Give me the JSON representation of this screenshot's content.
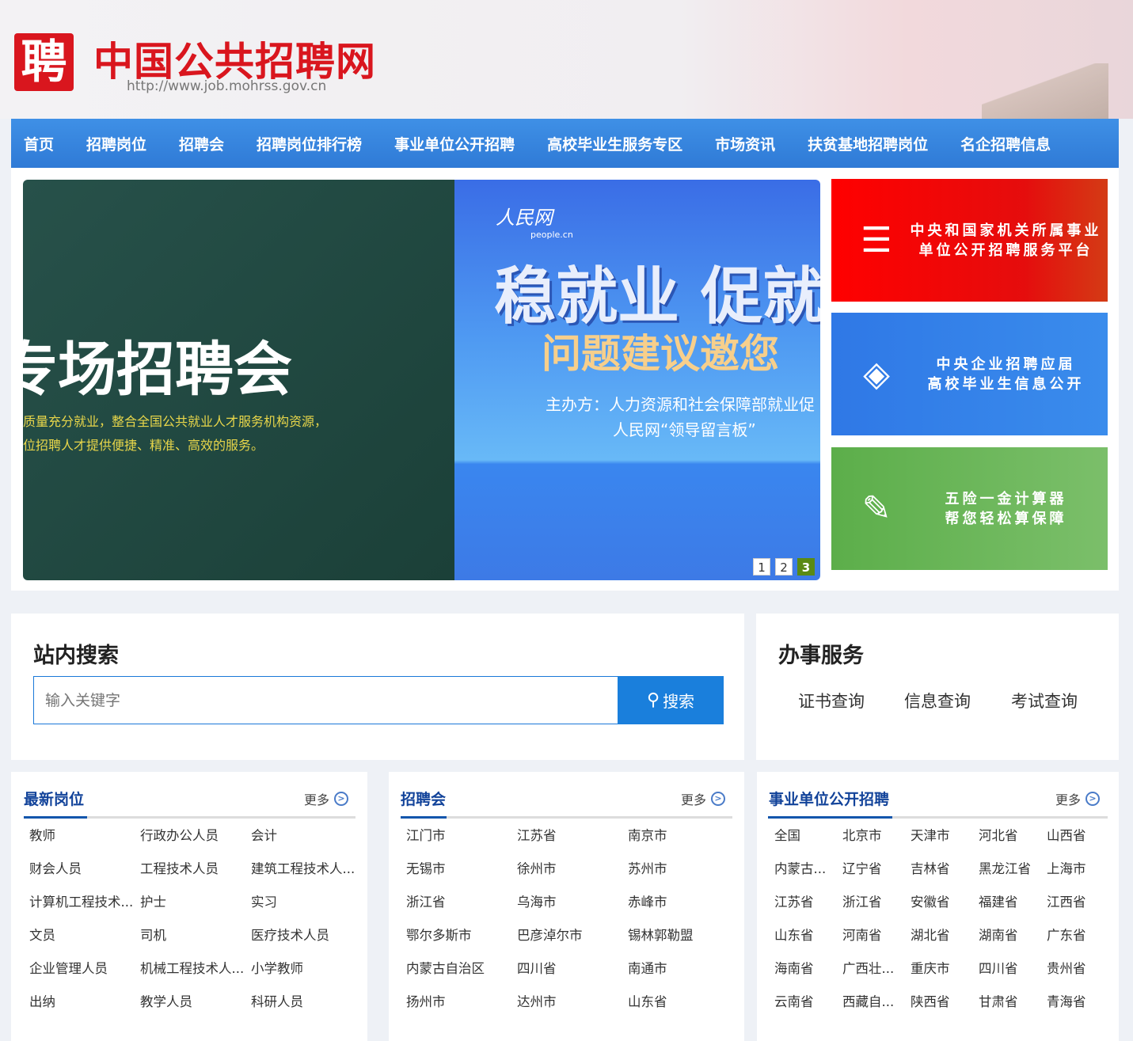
{
  "header": {
    "logo_mark": "聘",
    "site_name": "中国公共招聘网",
    "url": "http://www.job.mohrss.gov.cn"
  },
  "nav": [
    "首页",
    "招聘岗位",
    "招聘会",
    "招聘岗位排行榜",
    "事业单位公开招聘",
    "高校毕业生服务专区",
    "市场资讯",
    "扶贫基地招聘岗位",
    "名企招聘信息"
  ],
  "carousel": {
    "slide1": {
      "title": "专场招聘会",
      "line1": "质量充分就业，整合全国公共就业人才服务机构资源，",
      "line2": "位招聘人才提供便捷、精准、高效的服务。"
    },
    "slide2": {
      "logo": "人民网",
      "logo_sub": "people.cn",
      "title": "稳就业 促就",
      "subtitle": "问题建议邀您",
      "host": "主办方：人力资源和社会保障部就业促",
      "host2": "人民网“领导留言板”"
    },
    "pages": [
      "1",
      "2",
      "3"
    ],
    "active_page": 3
  },
  "cards": [
    {
      "line1": "中央和国家机关所属事业",
      "line2": "单位公开招聘服务平台",
      "icon": "search-list-icon"
    },
    {
      "line1": "中央企业招聘应届",
      "line2": "高校毕业生信息公开",
      "icon": "layers-icon"
    },
    {
      "line1": "五险一金计算器",
      "line2": "帮您轻松算保障",
      "icon": "edit-note-icon"
    }
  ],
  "search": {
    "title": "站内搜索",
    "placeholder": "输入关键字",
    "button": "搜索"
  },
  "services": {
    "title": "办事服务",
    "items": [
      "证书查询",
      "信息查询",
      "考试查询"
    ]
  },
  "lists": [
    {
      "title": "最新岗位",
      "more": "更多",
      "items": [
        "教师",
        "行政办公人员",
        "会计",
        "财会人员",
        "工程技术人员",
        "建筑工程技术人...",
        "计算机工程技术...",
        "护士",
        "实习",
        "文员",
        "司机",
        "医疗技术人员",
        "企业管理人员",
        "机械工程技术人...",
        "小学教师",
        "出纳",
        "教学人员",
        "科研人员"
      ]
    },
    {
      "title": "招聘会",
      "more": "更多",
      "items": [
        "江门市",
        "江苏省",
        "南京市",
        "无锡市",
        "徐州市",
        "苏州市",
        "浙江省",
        "乌海市",
        "赤峰市",
        "鄂尔多斯市",
        "巴彦淖尔市",
        "锡林郭勒盟",
        "内蒙古自治区",
        "四川省",
        "南通市",
        "扬州市",
        "达州市",
        "山东省"
      ]
    },
    {
      "title": "事业单位公开招聘",
      "more": "更多",
      "items": [
        "全国",
        "北京市",
        "天津市",
        "河北省",
        "山西省",
        "内蒙古...",
        "辽宁省",
        "吉林省",
        "黑龙江省",
        "上海市",
        "江苏省",
        "浙江省",
        "安徽省",
        "福建省",
        "江西省",
        "山东省",
        "河南省",
        "湖北省",
        "湖南省",
        "广东省",
        "海南省",
        "广西壮...",
        "重庆市",
        "四川省",
        "贵州省",
        "云南省",
        "西藏自...",
        "陕西省",
        "甘肃省",
        "青海省"
      ]
    }
  ]
}
